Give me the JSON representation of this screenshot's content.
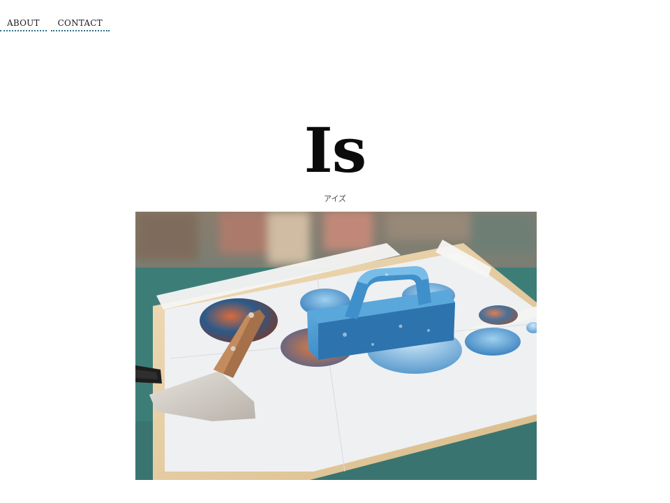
{
  "nav": {
    "items": [
      {
        "label": "ABOUT"
      },
      {
        "label": "CONTACT"
      }
    ],
    "underline_color": "#2a6f86"
  },
  "header": {
    "title": "Is",
    "subtitle": "アイズ"
  },
  "hero": {
    "subject": "screen printing squeegee and scraper on a framed print with circular photo prints",
    "palette": {
      "table": "#3d7d78",
      "paper": "#eef0f2",
      "frame": "#e2c9a0",
      "squeegee": "#4a9ad0",
      "scraper_handle": "#a5714a",
      "scraper_blade": "#c9c4bd"
    }
  }
}
